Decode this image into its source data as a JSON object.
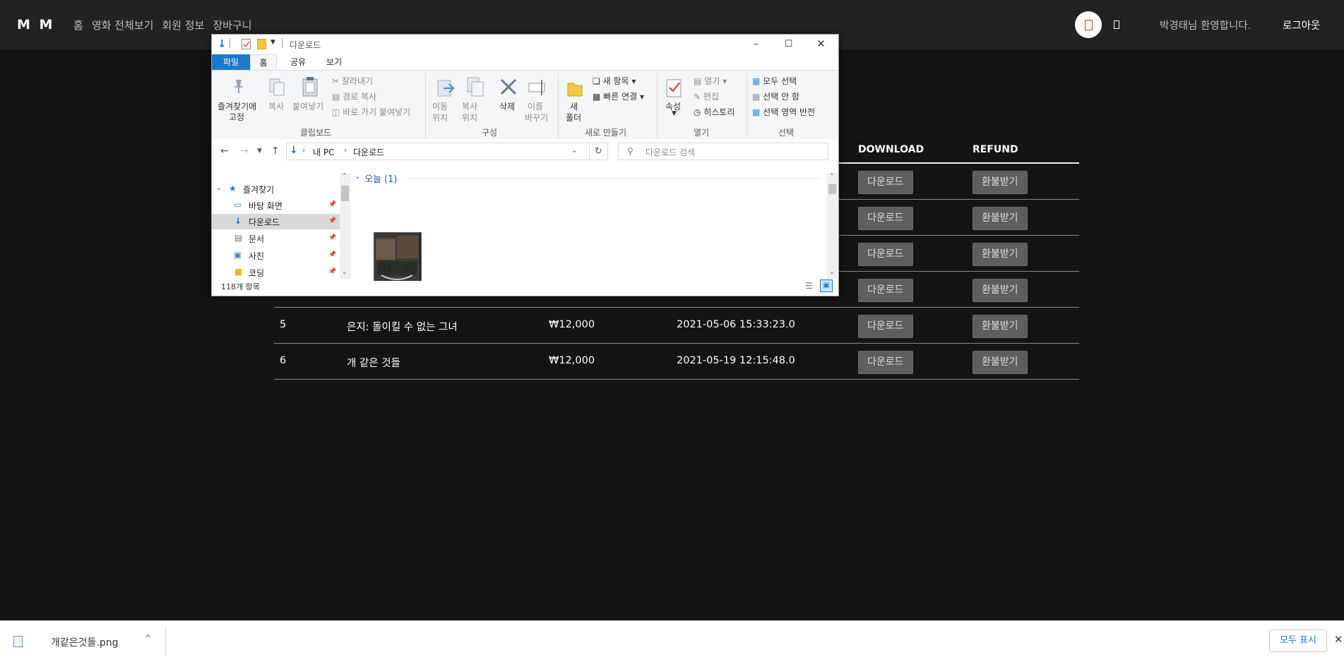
{
  "site": {
    "brand": "M M",
    "nav": [
      "홈",
      "영화 전체보기",
      "회원 정보",
      "장바구니"
    ],
    "welcome": "박경태님 환영합니다.",
    "logout": "로그아웃"
  },
  "table": {
    "headers": {
      "download": "DOWNLOAD",
      "refund": "REFUND"
    },
    "download_label": "다운로드",
    "refund_label": "환불받기",
    "rows": [
      {
        "no": "",
        "title": "",
        "price": "",
        "date": ""
      },
      {
        "no": "",
        "title": "",
        "price": "",
        "date": ""
      },
      {
        "no": "",
        "title": "",
        "price": "",
        "date": ""
      },
      {
        "no": "",
        "title": "",
        "price": "",
        "date": ""
      },
      {
        "no": "5",
        "title": "은지: 돌이킬 수 없는 그녀",
        "price": "₩12,000",
        "date": "2021-05-06 15:33:23.0"
      },
      {
        "no": "6",
        "title": "개 같은 것들",
        "price": "₩12,000",
        "date": "2021-05-19 12:15:48.0"
      }
    ]
  },
  "explorer": {
    "title": "다운로드",
    "tabs": {
      "file": "파일",
      "home": "홈",
      "share": "공유",
      "view": "보기"
    },
    "ribbon": {
      "pin_quick": [
        "즐겨찾기에",
        "고정"
      ],
      "copy": "복사",
      "paste": "붙여넣기",
      "cut": "잘라내기",
      "copy_path": "경로 복사",
      "paste_shortcut": "바로 가기 붙여넣기",
      "group_clipboard": "클립보드",
      "move_to": [
        "이동",
        "위치"
      ],
      "copy_to": [
        "복사",
        "위치"
      ],
      "delete": "삭제",
      "rename": [
        "이름",
        "바꾸기"
      ],
      "group_organize": "구성",
      "new_folder": [
        "새",
        "폴더"
      ],
      "new_item": "새 항목",
      "easy_access": "빠른 연결",
      "group_new": "새로 만들기",
      "properties": "속성",
      "open": "열기",
      "edit": "편집",
      "history": "히스토리",
      "group_open": "열기",
      "select_all": "모두 선택",
      "select_none": "선택 안 함",
      "invert_selection": "선택 영역 반전",
      "group_select": "선택"
    },
    "address": {
      "root": "내 PC",
      "folder": "다운로드"
    },
    "search_placeholder": "다운로드 검색",
    "nav": {
      "quick_access": "즐겨찾기",
      "items": [
        "바탕 화면",
        "다운로드",
        "문서",
        "사진",
        "코딩"
      ]
    },
    "group_header": "오늘 (1)",
    "file_name": "개같은것들",
    "status": "118개 항목"
  },
  "download_bar": {
    "file": "개같은것들.png",
    "show_all": "모두 표시"
  }
}
